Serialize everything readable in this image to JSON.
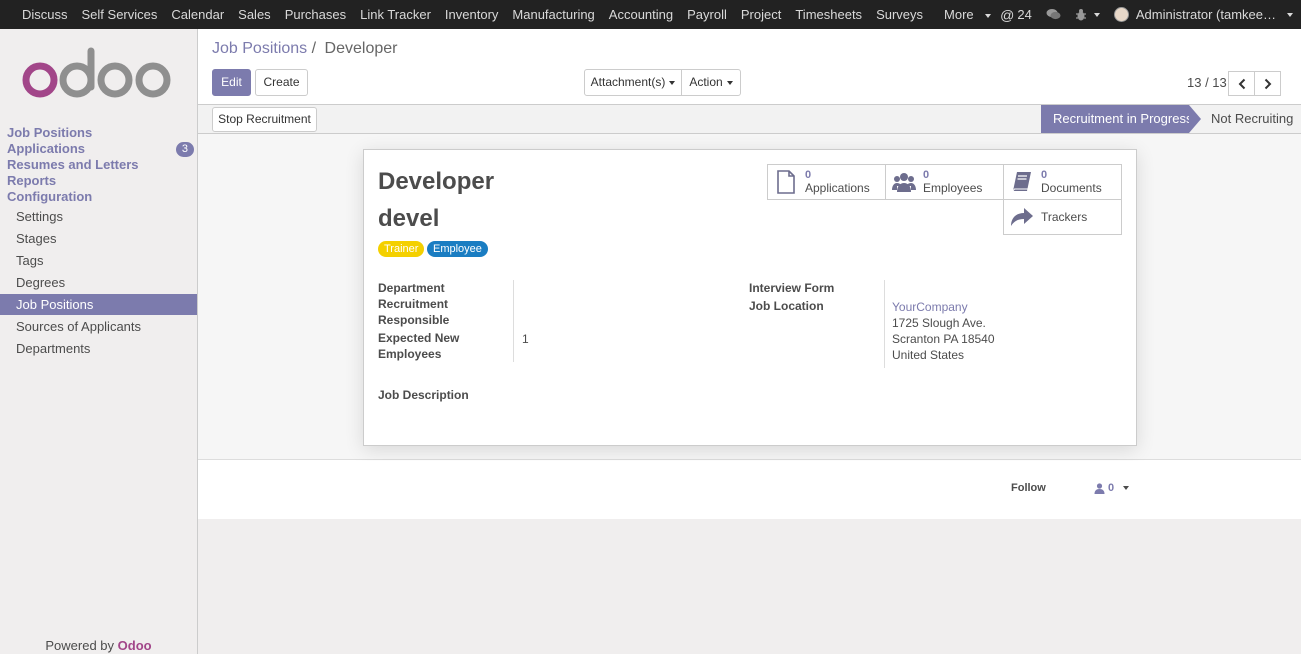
{
  "topbar": {
    "menu": [
      "Discuss",
      "Self Services",
      "Calendar",
      "Sales",
      "Purchases",
      "Link Tracker",
      "Inventory",
      "Manufacturing",
      "Accounting",
      "Payroll",
      "Project",
      "Timesheets",
      "Surveys",
      "More"
    ],
    "mentions_count": "24",
    "user_name": "Administrator (tamkee…"
  },
  "sidebar": {
    "sections": [
      "Job Positions",
      "Applications",
      "Resumes and Letters",
      "Reports",
      "Configuration"
    ],
    "applications_badge": "3",
    "config_items": [
      "Settings",
      "Stages",
      "Tags",
      "Degrees",
      "Job Positions",
      "Sources of Applicants",
      "Departments"
    ],
    "active_item": "Job Positions",
    "powered_by": "Powered by",
    "powered_brand": "Odoo"
  },
  "breadcrumb": {
    "parent": "Job Positions",
    "separator": "/",
    "current": "Developer"
  },
  "toolbar": {
    "edit": "Edit",
    "create": "Create",
    "attachments": "Attachment(s)",
    "action": "Action",
    "pager": "13 / 13"
  },
  "statusbar": {
    "button": "Stop Recruitment",
    "stages": [
      "Recruitment in Progress",
      "Not Recruiting"
    ],
    "active_stage": "Recruitment in Progress"
  },
  "form": {
    "title": "Developer",
    "subtitle": "devel",
    "tags": [
      {
        "label": "Trainer",
        "color": "#f4d000"
      },
      {
        "label": "Employee",
        "color": "#1a7dc2"
      }
    ],
    "smart_buttons": [
      {
        "count": "0",
        "label": "Applications",
        "icon": "file-icon"
      },
      {
        "count": "0",
        "label": "Employees",
        "icon": "users-icon"
      },
      {
        "count": "0",
        "label": "Documents",
        "icon": "book-icon"
      },
      {
        "count": "",
        "label": "Trackers",
        "icon": "share-icon"
      }
    ],
    "fields_left": {
      "department_label": "Department",
      "recruitment_responsible_label": "Recruitment Responsible",
      "expected_new_employees_label": "Expected New Employees",
      "expected_new_employees_value": "1"
    },
    "fields_right": {
      "interview_form_label": "Interview Form",
      "job_location_label": "Job Location",
      "company": "YourCompany",
      "address_line1": "1725 Slough Ave.",
      "address_line2": "Scranton PA 18540",
      "address_line3": "United States"
    },
    "job_description_label": "Job Description"
  },
  "chatter": {
    "follow": "Follow",
    "followers_count": "0"
  },
  "colors": {
    "primary": "#7c7bad",
    "navbar": "#222222",
    "brand": "#a24689"
  }
}
